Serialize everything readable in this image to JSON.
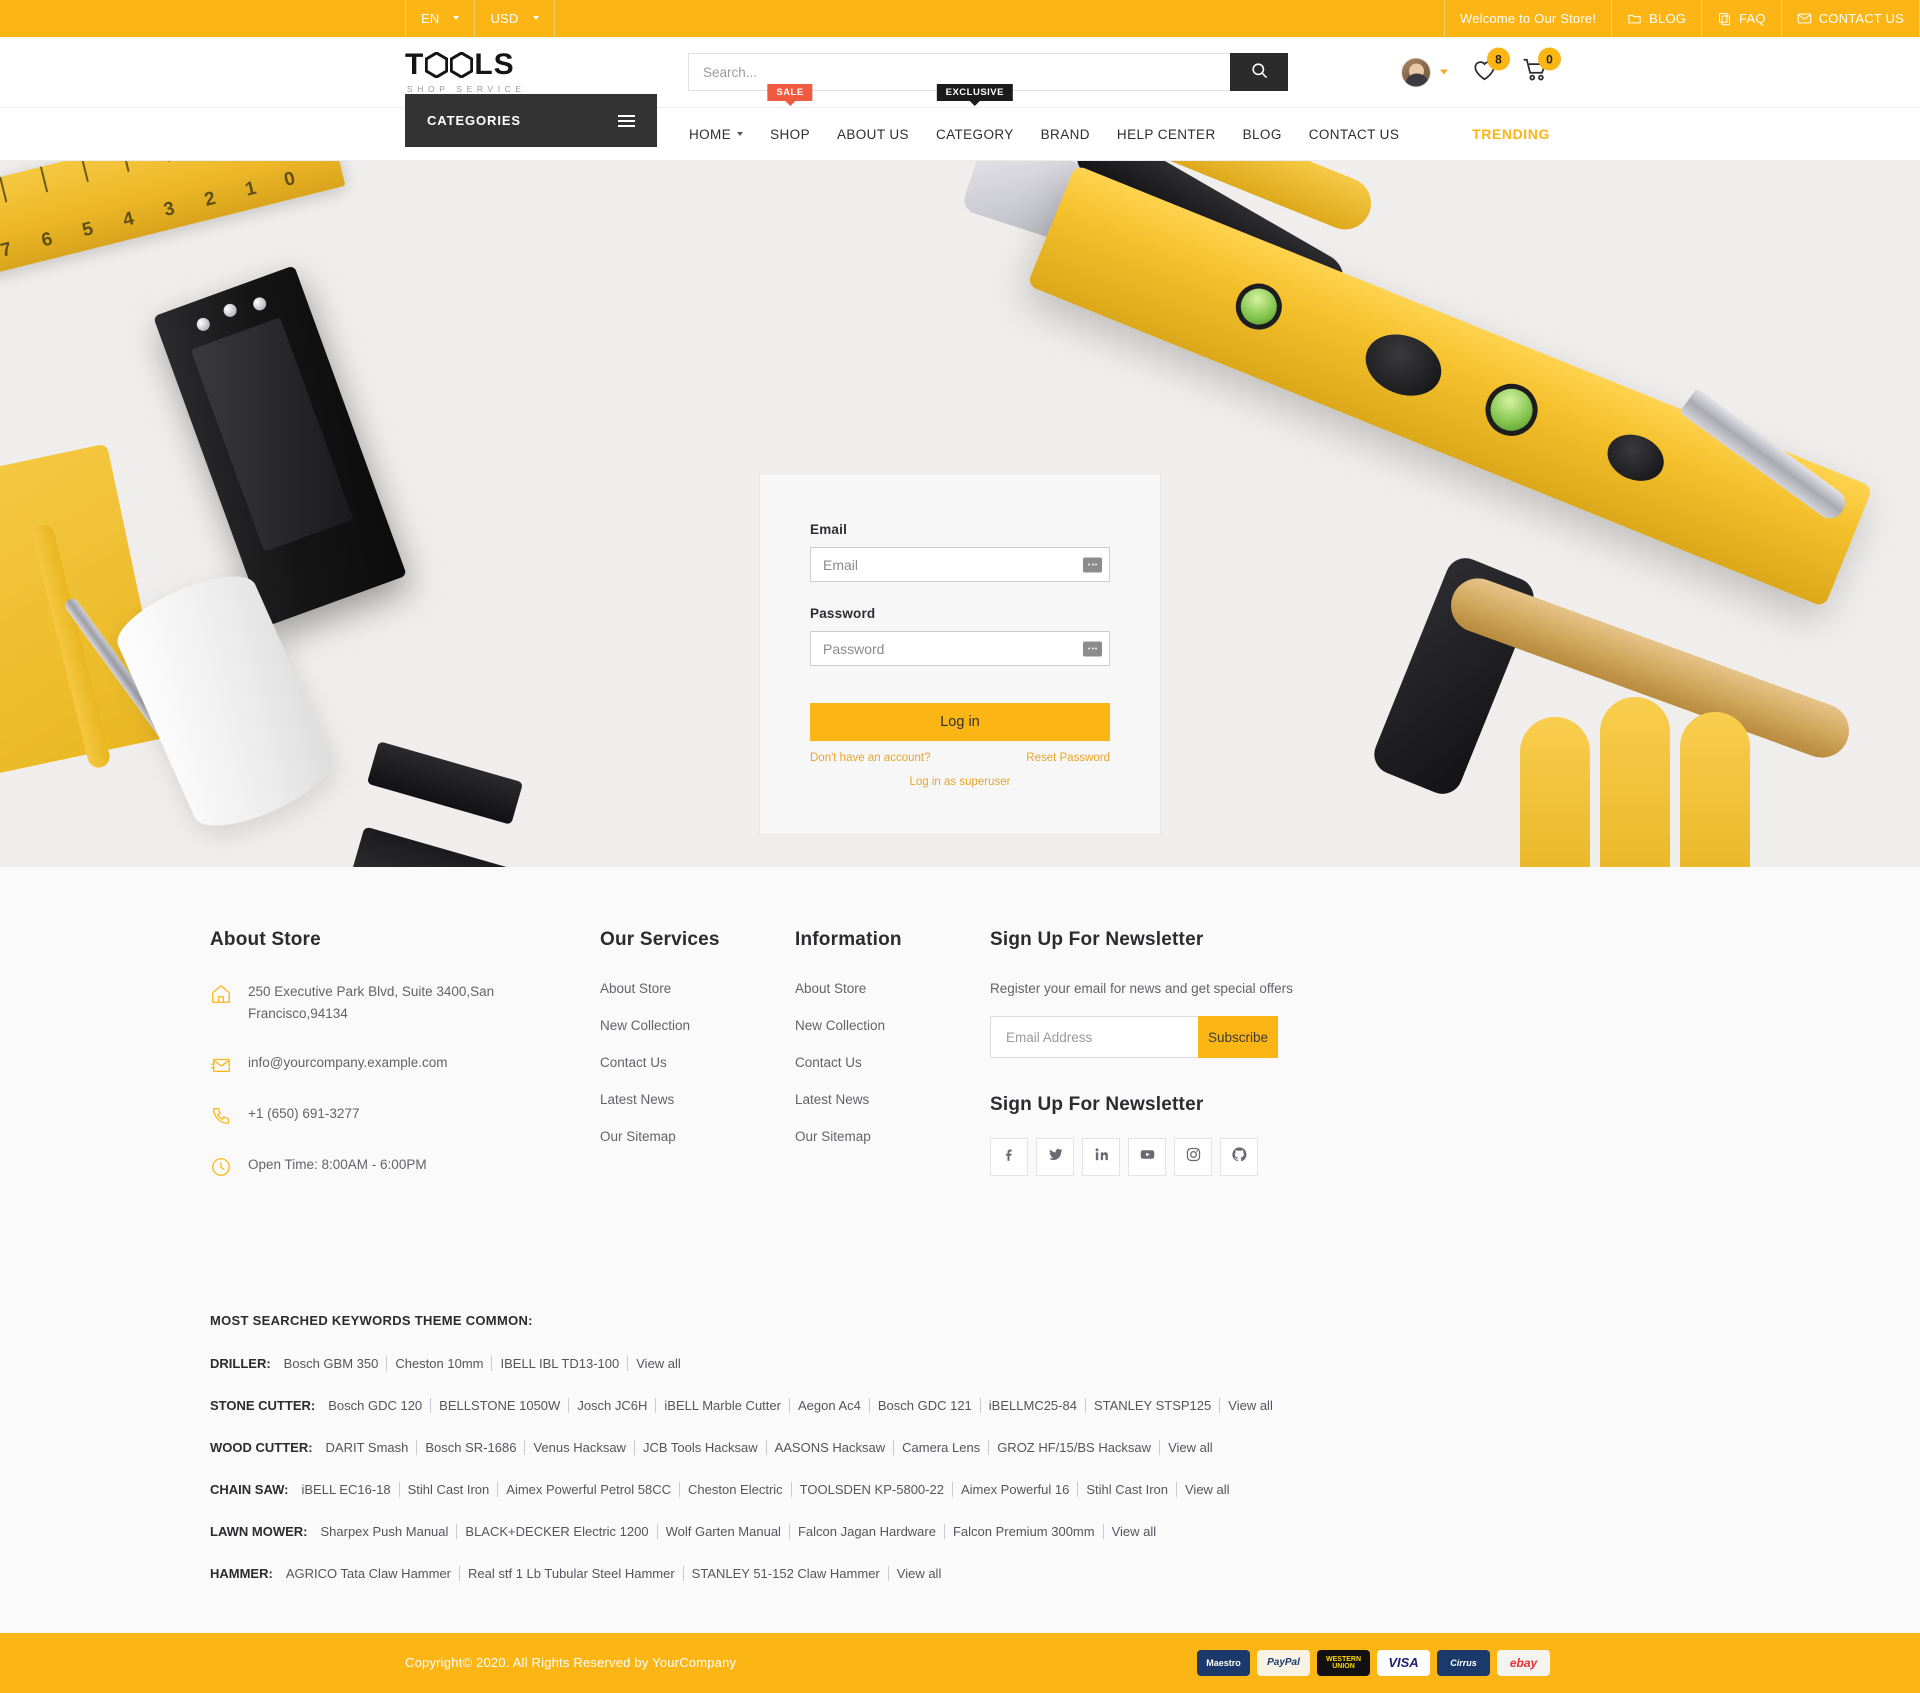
{
  "topbar": {
    "language": "EN",
    "currency": "USD",
    "welcome": "Welcome to Our Store!",
    "links": [
      {
        "label": "BLOG",
        "icon": "folder-icon"
      },
      {
        "label": "FAQ",
        "icon": "copy-icon"
      },
      {
        "label": "CONTACT US",
        "icon": "envelope-icon"
      }
    ]
  },
  "header": {
    "logo_main": "T",
    "logo_main_2": "LS",
    "logo_sub": "SHOP SERVICE",
    "search_placeholder": "Search...",
    "search_value": "",
    "wishlist_count": "8",
    "cart_count": "0"
  },
  "nav": {
    "categories_label": "CATEGORIES",
    "trending_label": "TRENDING",
    "items": [
      {
        "label": "HOME",
        "caret": true,
        "tag": ""
      },
      {
        "label": "SHOP",
        "caret": false,
        "tag": "SALE",
        "tag_kind": "sale"
      },
      {
        "label": "ABOUT US",
        "caret": false,
        "tag": ""
      },
      {
        "label": "CATEGORY",
        "caret": false,
        "tag": "EXCLUSIVE",
        "tag_kind": "exclusive"
      },
      {
        "label": "BRAND",
        "caret": false,
        "tag": ""
      },
      {
        "label": "HELP CENTER",
        "caret": false,
        "tag": ""
      },
      {
        "label": "BLOG",
        "caret": false,
        "tag": ""
      },
      {
        "label": "CONTACT US",
        "caret": false,
        "tag": ""
      }
    ]
  },
  "login": {
    "email_label": "Email",
    "email_placeholder": "Email",
    "email_value": "",
    "password_label": "Password",
    "password_placeholder": "Password",
    "password_value": "",
    "submit_label": "Log in",
    "signup_link": "Don't have an account?",
    "reset_link": "Reset Password",
    "superuser_link": "Log in as superuser"
  },
  "footer": {
    "about": {
      "heading": "About Store",
      "address": "250 Executive Park Blvd, Suite 3400,San Francisco,94134",
      "email": "info@yourcompany.example.com",
      "phone": "+1 (650) 691-3277",
      "hours": "Open Time: 8:00AM - 6:00PM"
    },
    "services": {
      "heading": "Our Services",
      "links": [
        "About Store",
        "New Collection",
        "Contact Us",
        "Latest News",
        "Our Sitemap"
      ]
    },
    "information": {
      "heading": "Information",
      "links": [
        "About Store",
        "New Collection",
        "Contact Us",
        "Latest News",
        "Our Sitemap"
      ]
    },
    "newsletter": {
      "heading": "Sign Up For Newsletter",
      "description": "Register your email for news and get special offers",
      "placeholder": "Email Address",
      "value": "",
      "button": "Subscribe",
      "social_heading": "Sign Up For Newsletter",
      "socials": [
        "facebook-icon",
        "twitter-icon",
        "linkedin-icon",
        "youtube-icon",
        "instagram-icon",
        "github-icon"
      ]
    }
  },
  "keywords": {
    "title": "MOST SEARCHED KEYWORDS THEME COMMON:",
    "view_all": "View all",
    "rows": [
      {
        "category": "DRILLER:",
        "items": [
          "Bosch GBM 350",
          "Cheston 10mm",
          "IBELL IBL TD13-100"
        ]
      },
      {
        "category": "STONE CUTTER:",
        "items": [
          "Bosch GDC 120",
          "BELLSTONE 1050W",
          "Josch JC6H",
          "iBELL Marble Cutter",
          "Aegon Ac4",
          "Bosch GDC 121",
          "iBELLMC25-84",
          "STANLEY STSP125"
        ]
      },
      {
        "category": "WOOD CUTTER:",
        "items": [
          "DARIT Smash",
          "Bosch SR-1686",
          "Venus Hacksaw",
          "JCB Tools Hacksaw",
          "AASONS Hacksaw",
          "Camera Lens",
          "GROZ HF/15/BS Hacksaw"
        ]
      },
      {
        "category": "CHAIN SAW:",
        "items": [
          "iBELL EC16-18",
          "Stihl Cast Iron",
          "Aimex Powerful Petrol 58CC",
          "Cheston Electric",
          "TOOLSDEN KP-5800-22",
          "Aimex Powerful 16",
          "Stihl Cast Iron"
        ]
      },
      {
        "category": "LAWN MOWER:",
        "items": [
          "Sharpex Push Manual",
          "BLACK+DECKER Electric 1200",
          "Wolf Garten Manual",
          "Falcon Jagan Hardware",
          "Falcon Premium 300mm"
        ]
      },
      {
        "category": "HAMMER:",
        "items": [
          "AGRICO Tata Claw Hammer",
          "Real stf 1 Lb Tubular Steel Hammer",
          "STANLEY 51-152 Claw Hammer"
        ]
      }
    ]
  },
  "copyright": {
    "text": "Copyright© 2020. All Rights Reserved by YourCompany",
    "payments": [
      {
        "name": "Maestro",
        "label": "Maestro"
      },
      {
        "name": "PayPal",
        "label": "PayPal"
      },
      {
        "name": "Western Union",
        "label": "WESTERN UNION"
      },
      {
        "name": "VISA",
        "label": "VISA"
      },
      {
        "name": "Cirrus",
        "label": "Cirrus"
      },
      {
        "name": "eBay",
        "label": "ebay"
      }
    ]
  },
  "colors": {
    "accent": "#fbb515",
    "dark": "#333333",
    "sale": "#f05a40",
    "exclusive": "#1b1b1b"
  }
}
